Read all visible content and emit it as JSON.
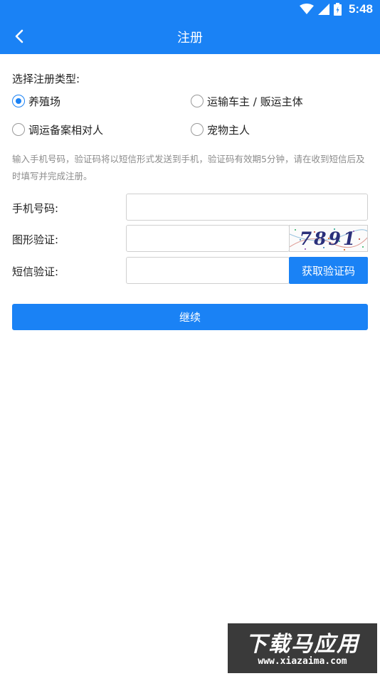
{
  "status_bar": {
    "time": "5:48",
    "icons": [
      "wifi-icon",
      "signal-icon",
      "battery-icon"
    ]
  },
  "header": {
    "title": "注册",
    "back_icon": "chevron-left-icon"
  },
  "register_type": {
    "label": "选择注册类型:",
    "options": [
      {
        "label": "养殖场",
        "selected": true
      },
      {
        "label": "运输车主 / 贩运主体",
        "selected": false
      },
      {
        "label": "调运备案相对人",
        "selected": false
      },
      {
        "label": "宠物主人",
        "selected": false
      }
    ]
  },
  "hint": "输入手机号码，验证码将以短信形式发送到手机，验证码有效期5分钟，请在收到短信后及时填写并完成注册。",
  "form": {
    "phone_label": "手机号码:",
    "phone_value": "",
    "captcha_label": "图形验证:",
    "captcha_value": "",
    "captcha_image_text": "7891",
    "sms_label": "短信验证:",
    "sms_value": "",
    "sms_button": "获取验证码"
  },
  "continue_button": "继续",
  "watermark": {
    "title": "下载马应用",
    "url": "www.xiazaima.com"
  },
  "colors": {
    "primary": "#1a82f5",
    "hint_text": "#8c8c8c",
    "border": "#cfcfcf"
  }
}
